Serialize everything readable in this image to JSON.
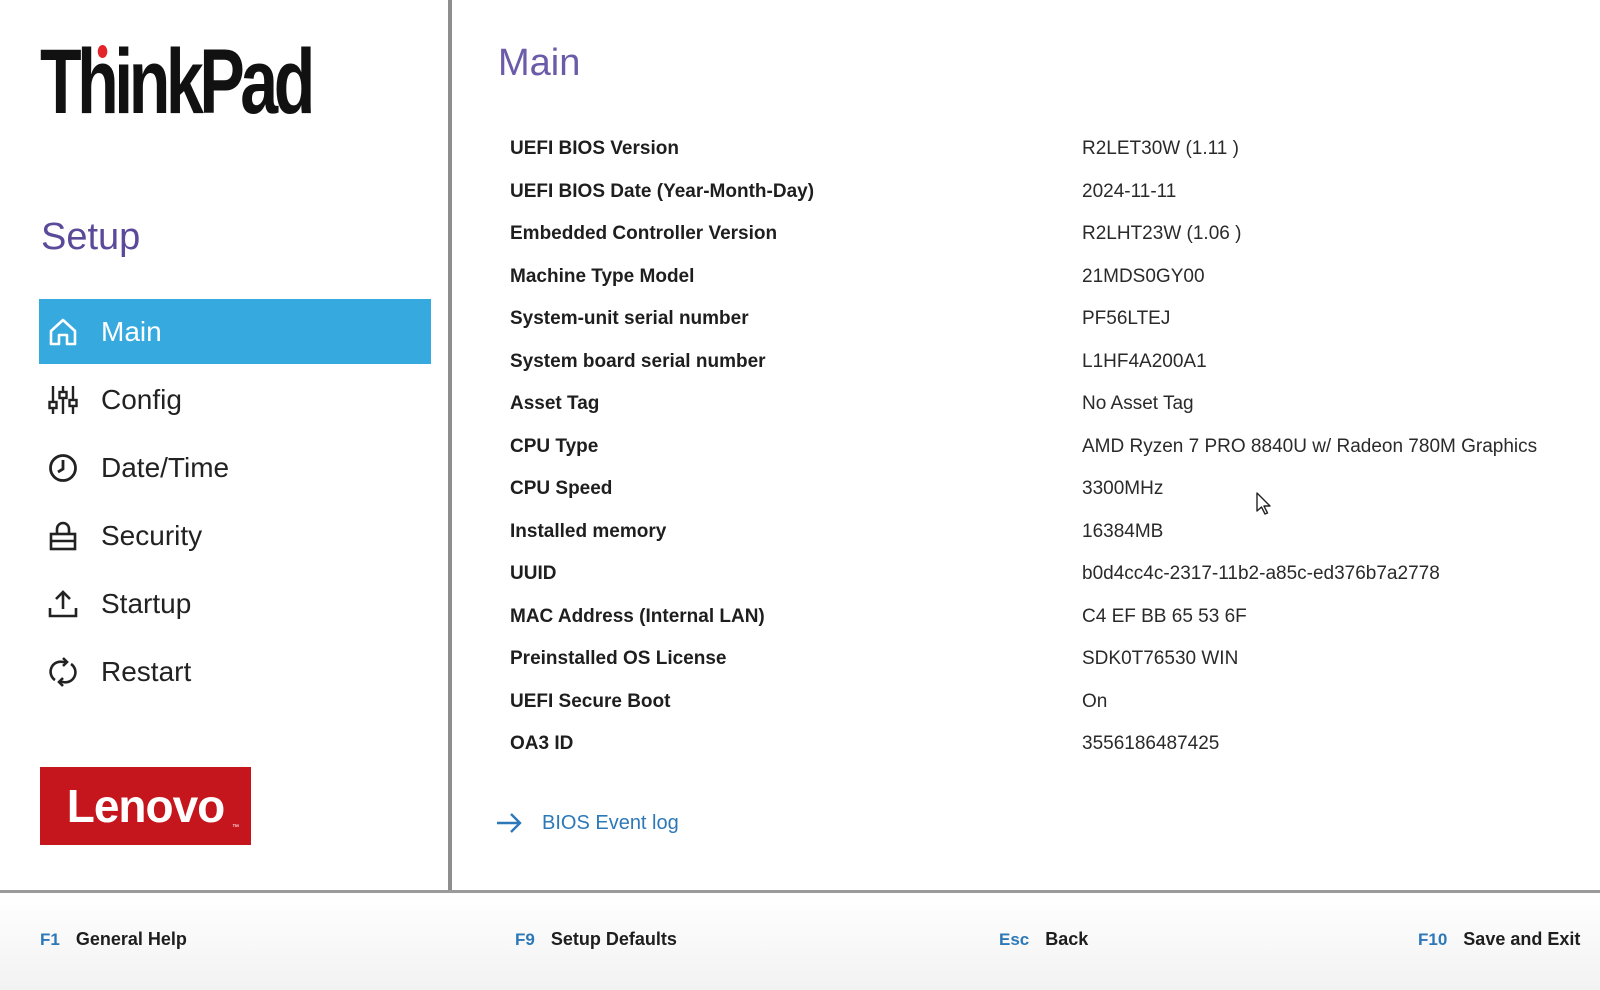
{
  "brand": {
    "thinkpad": "ThinkPad",
    "lenovo": "Lenovo",
    "lenovo_tm": "™"
  },
  "sidebar": {
    "title": "Setup",
    "items": [
      {
        "label": "Main",
        "icon": "home-icon",
        "active": true
      },
      {
        "label": "Config",
        "icon": "sliders-icon",
        "active": false
      },
      {
        "label": "Date/Time",
        "icon": "clock-icon",
        "active": false
      },
      {
        "label": "Security",
        "icon": "lock-icon",
        "active": false
      },
      {
        "label": "Startup",
        "icon": "upload-icon",
        "active": false
      },
      {
        "label": "Restart",
        "icon": "restart-icon",
        "active": false
      }
    ]
  },
  "main": {
    "title": "Main",
    "rows": [
      {
        "label": "UEFI BIOS Version",
        "value": "R2LET30W (1.11 )"
      },
      {
        "label": "UEFI BIOS Date (Year-Month-Day)",
        "value": "2024-11-11"
      },
      {
        "label": "Embedded Controller Version",
        "value": "R2LHT23W (1.06 )"
      },
      {
        "label": "Machine Type Model",
        "value": "21MDS0GY00"
      },
      {
        "label": "System-unit serial number",
        "value": "PF56LTEJ"
      },
      {
        "label": "System board serial number",
        "value": "L1HF4A200A1"
      },
      {
        "label": "Asset Tag",
        "value": "No Asset Tag"
      },
      {
        "label": "CPU Type",
        "value": "AMD Ryzen 7 PRO 8840U w/ Radeon 780M Graphics"
      },
      {
        "label": "CPU Speed",
        "value": "3300MHz"
      },
      {
        "label": "Installed memory",
        "value": "16384MB"
      },
      {
        "label": "UUID",
        "value": "b0d4cc4c-2317-11b2-a85c-ed376b7a2778"
      },
      {
        "label": "MAC Address (Internal LAN)",
        "value": "C4 EF BB 65 53 6F"
      },
      {
        "label": "Preinstalled OS License",
        "value": "SDK0T76530 WIN"
      },
      {
        "label": "UEFI Secure Boot",
        "value": "On"
      },
      {
        "label": "OA3 ID",
        "value": "3556186487425"
      }
    ],
    "event_log_label": "BIOS Event log"
  },
  "footer": [
    {
      "key": "F1",
      "label": "General Help"
    },
    {
      "key": "F9",
      "label": "Setup Defaults"
    },
    {
      "key": "Esc",
      "label": "Back"
    },
    {
      "key": "F10",
      "label": "Save and Exit"
    }
  ],
  "colors": {
    "accent": "#36a9df",
    "title": "#6b5ba8",
    "link": "#2d78b8",
    "lenovo_red": "#c4161c"
  }
}
